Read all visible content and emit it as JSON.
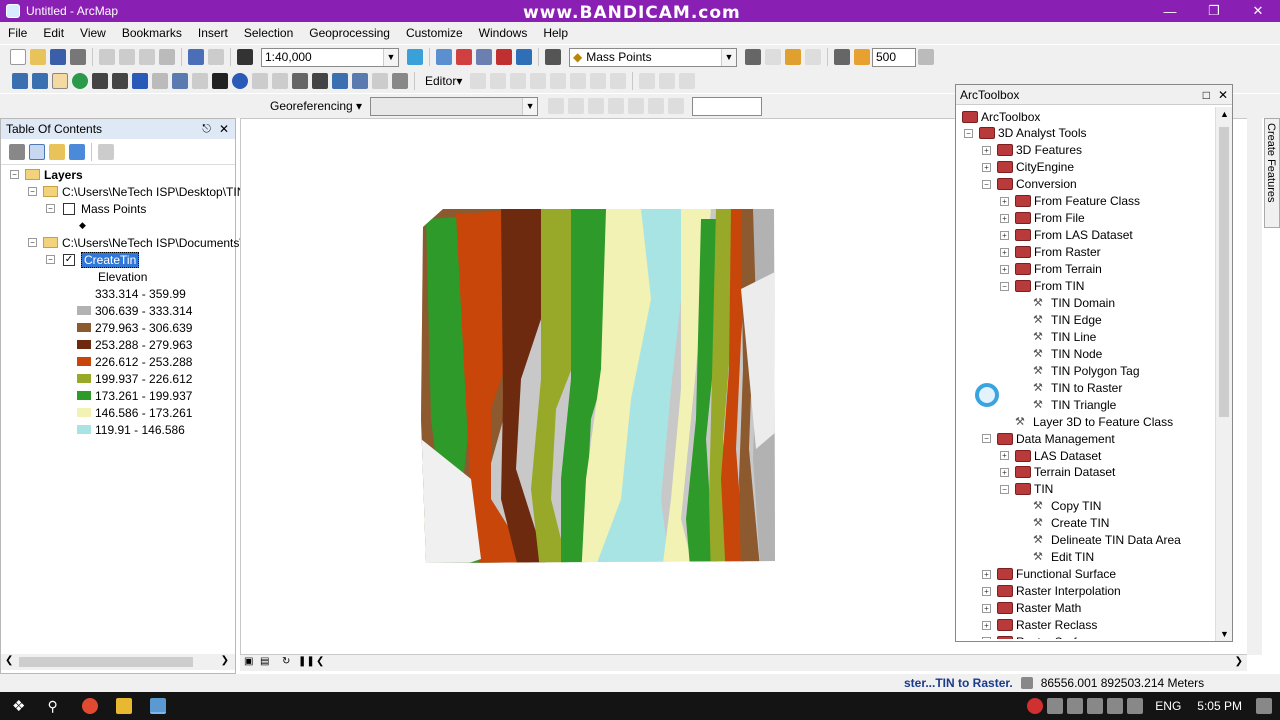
{
  "window": {
    "title": "Untitled - ArcMap",
    "watermark": "www.BANDICAM.com"
  },
  "menu": [
    "File",
    "Edit",
    "View",
    "Bookmarks",
    "Insert",
    "Selection",
    "Geoprocessing",
    "Customize",
    "Windows",
    "Help"
  ],
  "toolbar": {
    "scale": "1:40,000",
    "layer_combo": "Mass Points",
    "zoom_value": "500",
    "editor": "Editor▾",
    "georef": "Georeferencing ▾"
  },
  "toc": {
    "title": "Table Of Contents",
    "layers_label": "Layers",
    "path1": "C:\\Users\\NeTech ISP\\Desktop\\TIN",
    "mass_points": "Mass Points",
    "path2": "C:\\Users\\NeTech ISP\\Documents\\",
    "create_tin": "CreateTin",
    "elevation": "Elevation",
    "classes": [
      {
        "label": "333.314 - 359.99",
        "color": "#ffffff"
      },
      {
        "label": "306.639 - 333.314",
        "color": "#b2b2b2"
      },
      {
        "label": "279.963 - 306.639",
        "color": "#8c5a2e"
      },
      {
        "label": "253.288 - 279.963",
        "color": "#6e2a0e"
      },
      {
        "label": "226.612 - 253.288",
        "color": "#c8460a"
      },
      {
        "label": "199.937 - 226.612",
        "color": "#98a828"
      },
      {
        "label": "173.261 - 199.937",
        "color": "#2e9a2a"
      },
      {
        "label": "146.586 - 173.261",
        "color": "#f2f2b4"
      },
      {
        "label": "119.91 - 146.586",
        "color": "#a8e4e4"
      }
    ]
  },
  "arctoolbox": {
    "title": "ArcToolbox",
    "items": [
      {
        "label": "ArcToolbox",
        "level": 0,
        "type": "root"
      },
      {
        "label": "3D Analyst Tools",
        "level": 0,
        "type": "box",
        "exp": "-"
      },
      {
        "label": "3D Features",
        "level": 1,
        "type": "box",
        "exp": "+"
      },
      {
        "label": "CityEngine",
        "level": 1,
        "type": "box",
        "exp": "+"
      },
      {
        "label": "Conversion",
        "level": 1,
        "type": "box",
        "exp": "-"
      },
      {
        "label": "From Feature Class",
        "level": 2,
        "type": "box",
        "exp": "+"
      },
      {
        "label": "From File",
        "level": 2,
        "type": "box",
        "exp": "+"
      },
      {
        "label": "From LAS Dataset",
        "level": 2,
        "type": "box",
        "exp": "+"
      },
      {
        "label": "From Raster",
        "level": 2,
        "type": "box",
        "exp": "+"
      },
      {
        "label": "From Terrain",
        "level": 2,
        "type": "box",
        "exp": "+"
      },
      {
        "label": "From TIN",
        "level": 2,
        "type": "box",
        "exp": "-"
      },
      {
        "label": "TIN Domain",
        "level": 3,
        "type": "tool"
      },
      {
        "label": "TIN Edge",
        "level": 3,
        "type": "tool"
      },
      {
        "label": "TIN Line",
        "level": 3,
        "type": "tool"
      },
      {
        "label": "TIN Node",
        "level": 3,
        "type": "tool"
      },
      {
        "label": "TIN Polygon Tag",
        "level": 3,
        "type": "tool"
      },
      {
        "label": "TIN to Raster",
        "level": 3,
        "type": "tool"
      },
      {
        "label": "TIN Triangle",
        "level": 3,
        "type": "tool"
      },
      {
        "label": "Layer 3D to Feature Class",
        "level": 2,
        "type": "tool"
      },
      {
        "label": "Data Management",
        "level": 1,
        "type": "box",
        "exp": "-"
      },
      {
        "label": "LAS Dataset",
        "level": 2,
        "type": "box",
        "exp": "+"
      },
      {
        "label": "Terrain Dataset",
        "level": 2,
        "type": "box",
        "exp": "+"
      },
      {
        "label": "TIN",
        "level": 2,
        "type": "box",
        "exp": "-"
      },
      {
        "label": "Copy TIN",
        "level": 3,
        "type": "tool"
      },
      {
        "label": "Create TIN",
        "level": 3,
        "type": "tool"
      },
      {
        "label": "Delineate TIN Data Area",
        "level": 3,
        "type": "tool"
      },
      {
        "label": "Edit TIN",
        "level": 3,
        "type": "tool"
      },
      {
        "label": "Functional Surface",
        "level": 1,
        "type": "box",
        "exp": "+"
      },
      {
        "label": "Raster Interpolation",
        "level": 1,
        "type": "box",
        "exp": "+"
      },
      {
        "label": "Raster Math",
        "level": 1,
        "type": "box",
        "exp": "+"
      },
      {
        "label": "Raster Reclass",
        "level": 1,
        "type": "box",
        "exp": "+"
      },
      {
        "label": "Raster Surface",
        "level": 1,
        "type": "box",
        "exp": "+"
      }
    ]
  },
  "side_tab": "Create Features",
  "status": {
    "message": "ster...TIN to Raster.",
    "coords": "86556.001  892503.214 Meters"
  },
  "taskbar": {
    "lang": "ENG",
    "time": "5:05 PM"
  }
}
